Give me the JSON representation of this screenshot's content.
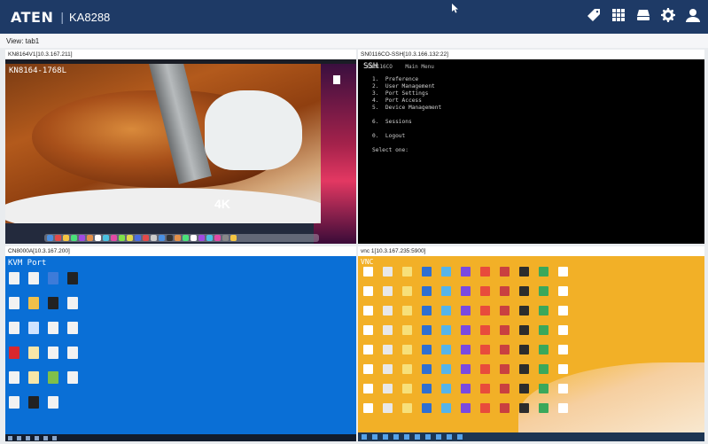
{
  "header": {
    "logo": "ATEN",
    "product": "KA8288",
    "icons": [
      "tag-icon",
      "grid-icon",
      "device-icon",
      "gear-icon",
      "user-icon"
    ],
    "bg_color": "#1e3a66"
  },
  "viewbar": {
    "label": "View:  tab1"
  },
  "panels": [
    {
      "title": "KN8164V1[10.3.167.211]",
      "screen_label": "KN8164-1768L"
    },
    {
      "title": "SN0116CO-SSH[10.3.166.132:22]",
      "screen_label": "SSH",
      "terminal_head": "SN0116CO    Main Menu",
      "terminal_lines": [
        "1.  Preference",
        "2.  User Management",
        "3.  Port Settings",
        "4.  Port Access",
        "5.  Device Management",
        "",
        "6.  Sessions",
        "",
        "0.  Logout",
        "",
        "Select one:"
      ]
    },
    {
      "title": "CN8000A[10.3.167.200]",
      "screen_label": "KVM Port"
    },
    {
      "title": "vnc 1[10.3.167.235:5900]",
      "screen_label": "VNC"
    }
  ],
  "video_badge": "4K"
}
